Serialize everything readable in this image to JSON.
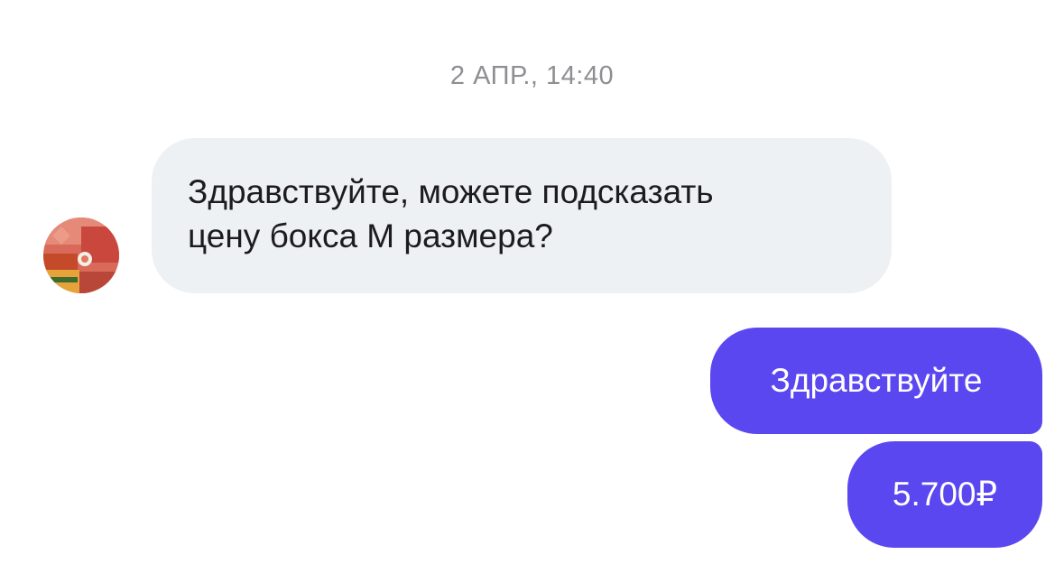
{
  "conversation": {
    "date_separator": "2 АПР., 14:40",
    "messages": [
      {
        "direction": "incoming",
        "text": "Здравствуйте, можете подсказать цену бокса М размера?",
        "line1": "Здравствуйте, можете подсказать",
        "line2": "цену бокса М размера?"
      },
      {
        "direction": "outgoing",
        "text": "Здравствуйте"
      },
      {
        "direction": "outgoing",
        "text": "5.700₽"
      }
    ]
  },
  "colors": {
    "incoming_bubble": "#eef1f4",
    "outgoing_bubble": "#5b47f0",
    "timestamp_text": "#8e8e93"
  },
  "icons": {
    "avatar": "contact-avatar-photo"
  }
}
